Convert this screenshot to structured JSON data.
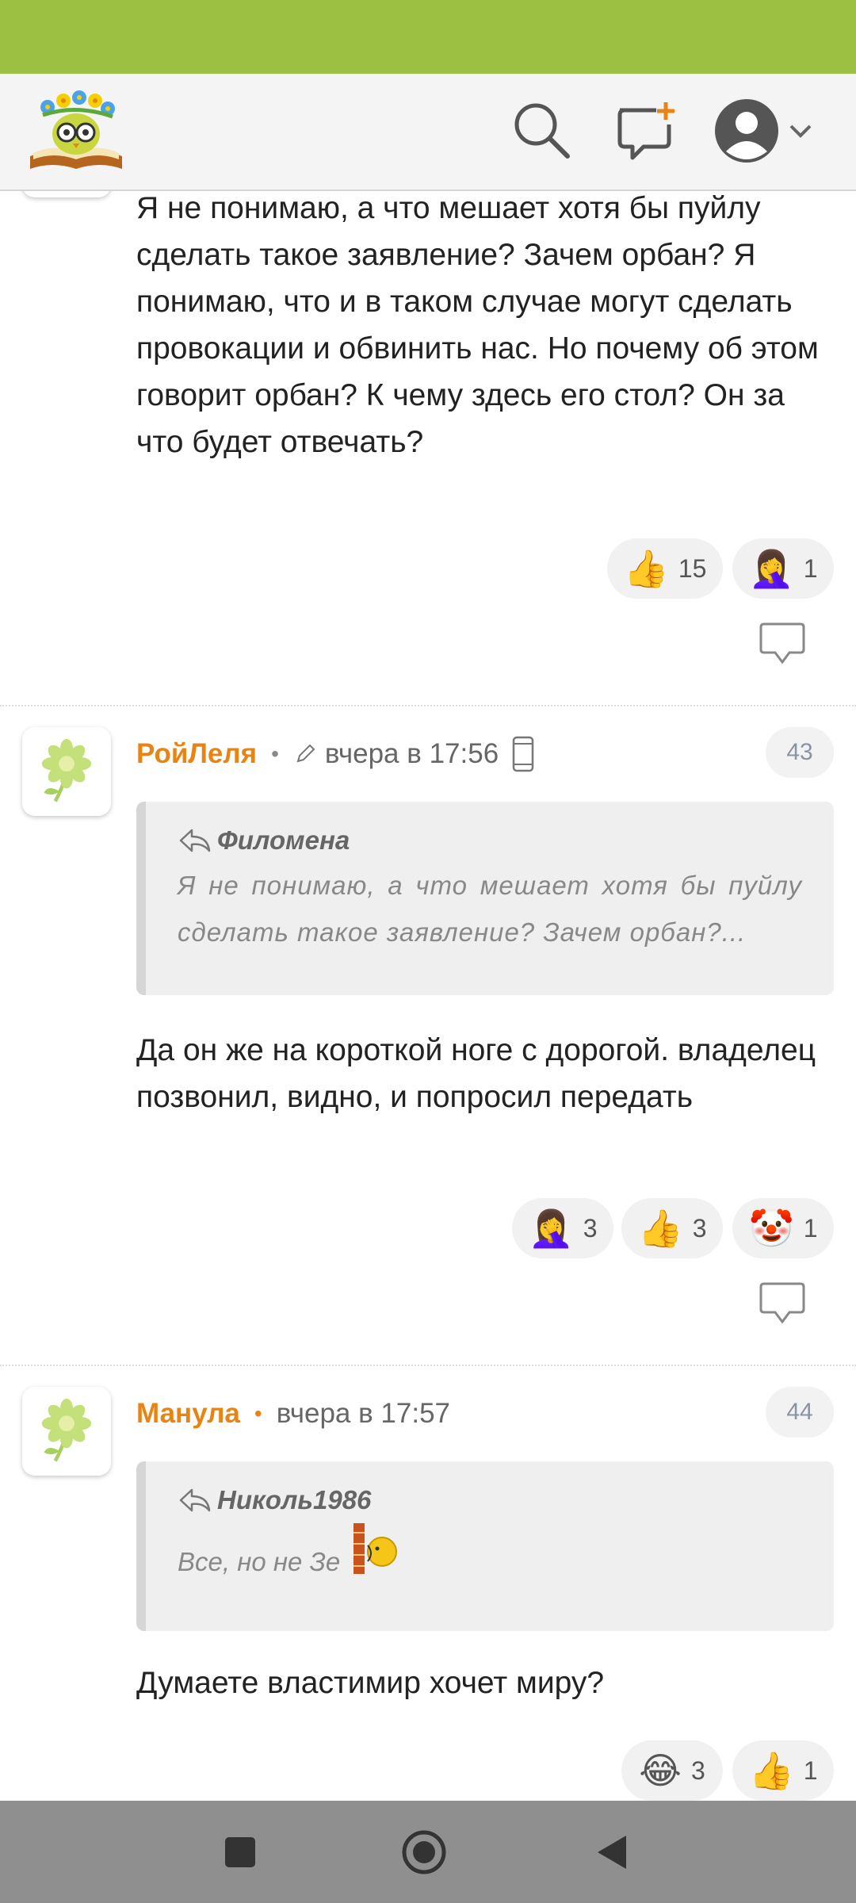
{
  "header": {
    "logo_icon": "book-owl-logo",
    "search_icon": "search-icon",
    "new_message_icon": "new-message-icon",
    "profile_icon": "user-avatar-icon"
  },
  "comments": [
    {
      "text": "Я не понимаю, а что мешает хотя бы пуйлу сделать такое заявление? Зачем орбан? Я понимаю, что и в таком случае могут сделать провокации и обвинить нас. Но почему об этом говорит орбан? К чему здесь его стол? Он за что будет отвечать?",
      "reactions": [
        {
          "emoji": "👍",
          "count": "15"
        },
        {
          "emoji": "🤦‍♀️",
          "count": "1"
        }
      ]
    },
    {
      "author": "РойЛеля",
      "time": "вчера в 17:56",
      "number": "43",
      "quote": {
        "author": "Филомена",
        "text": "Я не понимаю, а что мешает хотя бы пуйлу сделать такое заявление? Зачем орбан?..."
      },
      "text": "Да он же на короткой ноге с дорогой. владелец позвонил, видно, и попросил передать",
      "reactions": [
        {
          "emoji": "🤦‍♀️",
          "count": "3"
        },
        {
          "emoji": "👍",
          "count": "3"
        },
        {
          "emoji": "🤡",
          "count": "1"
        }
      ]
    },
    {
      "author": "Манула",
      "time": "вчера в 17:57",
      "number": "44",
      "quote": {
        "author": "Николь1986",
        "text": "Все, но не Зе"
      },
      "text": "Думаете властимир хочет миру?",
      "reactions": [
        {
          "emoji": "😂",
          "count": "3"
        },
        {
          "emoji": "👍",
          "count": "1"
        }
      ]
    }
  ],
  "nav": {
    "recents_icon": "square-icon",
    "home_icon": "circle-icon",
    "back_icon": "triangle-back-icon"
  },
  "colors": {
    "status_bar": "#9cc142",
    "author": "#e88414",
    "nav_bar": "#8f8f8f"
  }
}
